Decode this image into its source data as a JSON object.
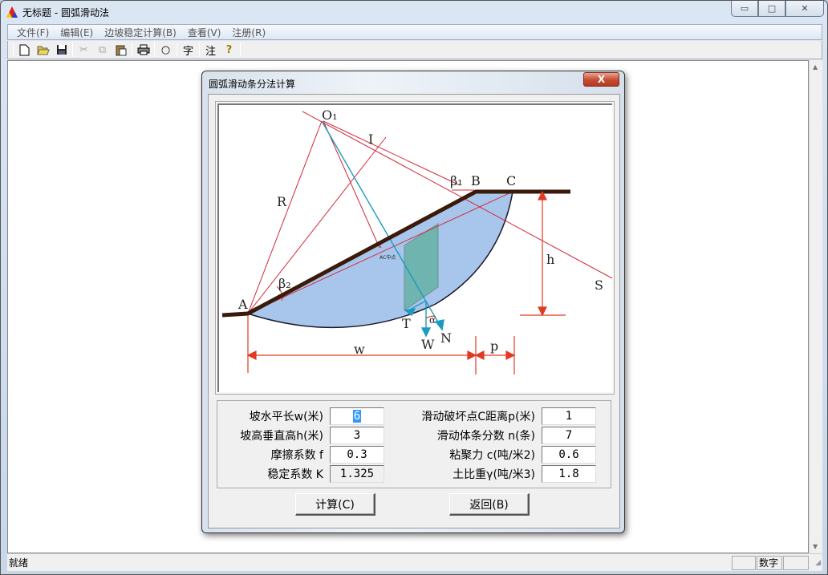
{
  "window": {
    "title": "无标题 - 圆弧滑动法",
    "minimize_glyph": "▭",
    "maximize_glyph": "□",
    "close_glyph": "✕"
  },
  "menu": [
    "文件(F)",
    "编辑(E)",
    "边坡稳定计算(B)",
    "查看(V)",
    "注册(R)"
  ],
  "toolbar": {
    "new": "🗋",
    "open": "📂",
    "save": "💾",
    "cut": "✂",
    "copy": "⧉",
    "paste": "📋",
    "print": "🖶",
    "circle": "○",
    "char": "字",
    "note": "注",
    "help": "?"
  },
  "status": {
    "text": "就绪",
    "num": "数字"
  },
  "dialog": {
    "title": "圆弧滑动条分法计算",
    "close_glyph": "X",
    "diagram_labels": {
      "O1": "O₁",
      "I": "I",
      "R": "R",
      "beta1": "β₁",
      "B": "B",
      "C": "C",
      "h": "h",
      "S": "S",
      "A": "A",
      "beta2": "β₂",
      "T": "T",
      "W": "W",
      "N": "N",
      "alpha": "α",
      "w": "w",
      "p": "p",
      "ac_mid": "AC中点"
    },
    "fields": {
      "w": {
        "label": "坡水平长w(米)",
        "value": "6"
      },
      "h": {
        "label": "坡高垂直高h(米)",
        "value": "3"
      },
      "f": {
        "label": "摩擦系数 f",
        "value": "0.3"
      },
      "K": {
        "label": "稳定系数 K",
        "value": "1.325"
      },
      "p": {
        "label": "滑动破坏点C距离p(米)",
        "value": "1"
      },
      "n": {
        "label": "滑动体条分数 n(条)",
        "value": "7"
      },
      "c": {
        "label": "粘聚力 c(吨/米2)",
        "value": "0.6"
      },
      "gamma": {
        "label": "土比重γ(吨/米3)",
        "value": "1.8"
      }
    },
    "buttons": {
      "calc": "计算(C)",
      "back": "返回(B)"
    }
  }
}
